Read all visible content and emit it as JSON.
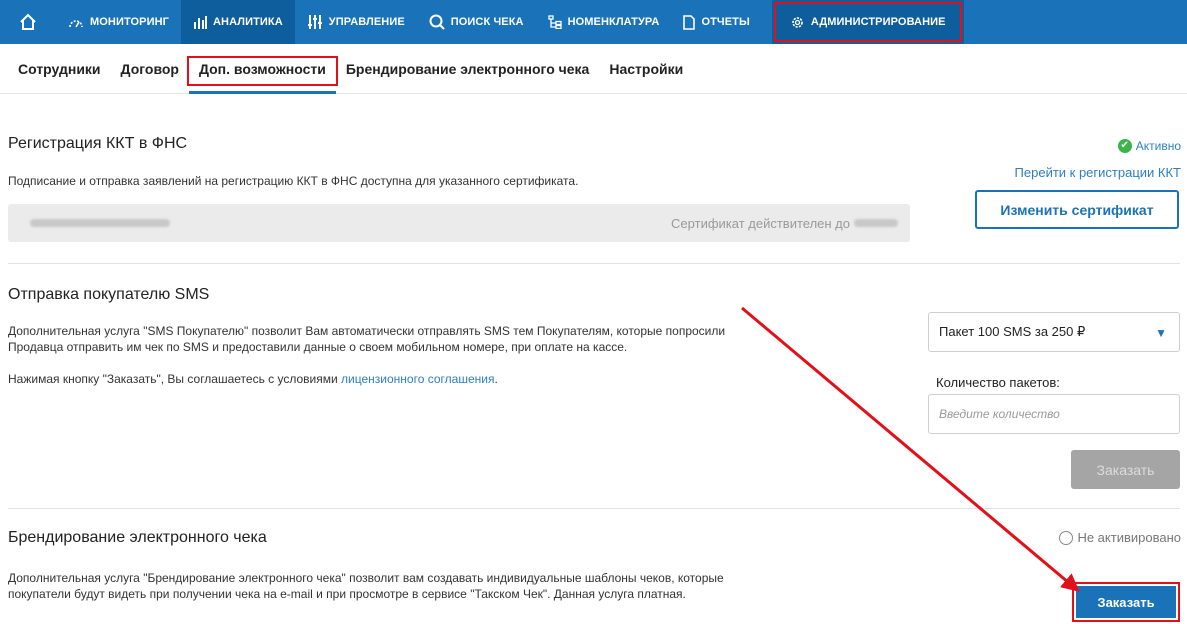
{
  "topnav": {
    "items": [
      {
        "label": "МОНИТОРИНГ",
        "icon": "gauge-icon"
      },
      {
        "label": "АНАЛИТИКА",
        "icon": "bar-chart-icon"
      },
      {
        "label": "УПРАВЛЕНИЕ",
        "icon": "sliders-icon"
      },
      {
        "label": "ПОИСК ЧЕКА",
        "icon": "search-icon"
      },
      {
        "label": "НОМЕНКЛАТУРА",
        "icon": "hierarchy-icon"
      },
      {
        "label": "ОТЧЕТЫ",
        "icon": "document-icon"
      },
      {
        "label": "АДМИНИСТРИРОВАНИЕ",
        "icon": "gear-icon"
      }
    ],
    "home_icon": "home-icon"
  },
  "subtabs": [
    {
      "label": "Сотрудники"
    },
    {
      "label": "Договор"
    },
    {
      "label": "Доп. возможности"
    },
    {
      "label": "Брендирование электронного чека"
    },
    {
      "label": "Настройки"
    }
  ],
  "kkt": {
    "title": "Регистрация ККТ в ФНС",
    "status": "Активно",
    "description": "Подписание и отправка заявлений на регистрацию ККТ в ФНС доступна для указанного сертификата.",
    "link": "Перейти к регистрации ККТ",
    "cert_valid_label": "Сертификат действителен до",
    "change_button": "Изменить сертификат"
  },
  "sms": {
    "title": "Отправка покупателю SMS",
    "description_line1": "Дополнительная услуга \"SMS Покупателю\" позволит Вам автоматически отправлять SMS тем Покупателям, которые попросили",
    "description_line2": "Продавца отправить им чек по SMS и предоставили данные о своем мобильном номере, при оплате на кассе.",
    "agree_text": "Нажимая кнопку \"Заказать\", Вы соглашаетесь с условиями ",
    "agree_link": "лицензионного соглашения",
    "agree_end": ".",
    "package_selected": "Пакет 100 SMS за 250 ₽",
    "qty_label": "Количество пакетов:",
    "qty_placeholder": "Введите количество",
    "order_button": "Заказать"
  },
  "branding": {
    "title": "Брендирование электронного чека",
    "status": "Не активировано",
    "description_line1": "Дополнительная услуга \"Брендирование электронного чека\" позволит вам создавать индивидуальные шаблоны чеков, которые",
    "description_line2": "покупатели будут видеть при получении чека на e-mail и при просмотре в сервисе \"Такском Чек\". Данная услуга платная.",
    "order_button": "Заказать"
  },
  "colors": {
    "nav": "#1a73b8",
    "nav_active": "#0e5d9c",
    "highlight": "#e3101a",
    "success": "#3bb54a",
    "link": "#2c7fc0"
  }
}
